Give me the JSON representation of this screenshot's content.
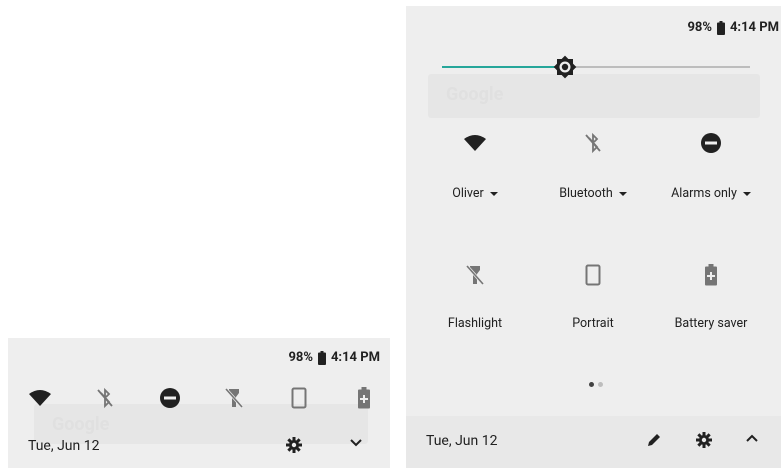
{
  "collapsed": {
    "status": {
      "battery": "98%",
      "time": "4:14 PM"
    },
    "tiles": [
      {
        "name": "wifi-icon"
      },
      {
        "name": "bluetooth-off-icon"
      },
      {
        "name": "do-not-disturb-icon"
      },
      {
        "name": "flashlight-off-icon"
      },
      {
        "name": "portrait-icon"
      },
      {
        "name": "battery-saver-icon"
      }
    ],
    "ghost_search": "Google",
    "footer": {
      "date": "Tue, Jun 12"
    }
  },
  "expanded": {
    "status": {
      "battery": "98%",
      "time": "4:14 PM"
    },
    "brightness": {
      "level": 0.4
    },
    "ghost_search": "Google",
    "tiles": [
      {
        "label": "Oliver",
        "icon": "wifi-icon",
        "has_caret": true
      },
      {
        "label": "Bluetooth",
        "icon": "bluetooth-off-icon",
        "has_caret": true
      },
      {
        "label": "Alarms only",
        "icon": "do-not-disturb-icon",
        "has_caret": true
      },
      {
        "label": "Flashlight",
        "icon": "flashlight-off-icon",
        "has_caret": false
      },
      {
        "label": "Portrait",
        "icon": "portrait-icon",
        "has_caret": false
      },
      {
        "label": "Battery saver",
        "icon": "battery-saver-icon",
        "has_caret": false
      }
    ],
    "page_indicator": {
      "pages": 2,
      "current": 1
    },
    "footer": {
      "date": "Tue, Jun 12"
    }
  },
  "colors": {
    "accent": "#26a69a",
    "icon_dark": "#212121",
    "icon_muted": "#757575"
  }
}
